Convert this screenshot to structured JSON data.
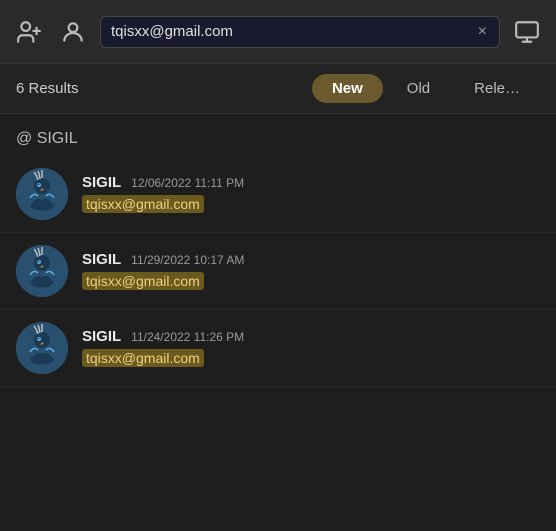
{
  "topbar": {
    "search_value": "tqisxx@gmail.com",
    "clear_label": "×",
    "add_user_icon": "add-user",
    "profile_icon": "profile",
    "messages_icon": "messages"
  },
  "filter_bar": {
    "results_count": "6 Results",
    "tabs": [
      {
        "id": "new",
        "label": "New",
        "active": true
      },
      {
        "id": "old",
        "label": "Old",
        "active": false
      },
      {
        "id": "relevant",
        "label": "Rele…",
        "active": false
      }
    ]
  },
  "section": {
    "label": "@ SIGIL"
  },
  "results": [
    {
      "username": "SIGIL",
      "timestamp": "12/06/2022 11:11 PM",
      "email": "tqisxx@gmail.com"
    },
    {
      "username": "SIGIL",
      "timestamp": "11/29/2022 10:17 AM",
      "email": "tqisxx@gmail.com"
    },
    {
      "username": "SIGIL",
      "timestamp": "11/24/2022 11:26 PM",
      "email": "tqisxx@gmail.com"
    }
  ]
}
